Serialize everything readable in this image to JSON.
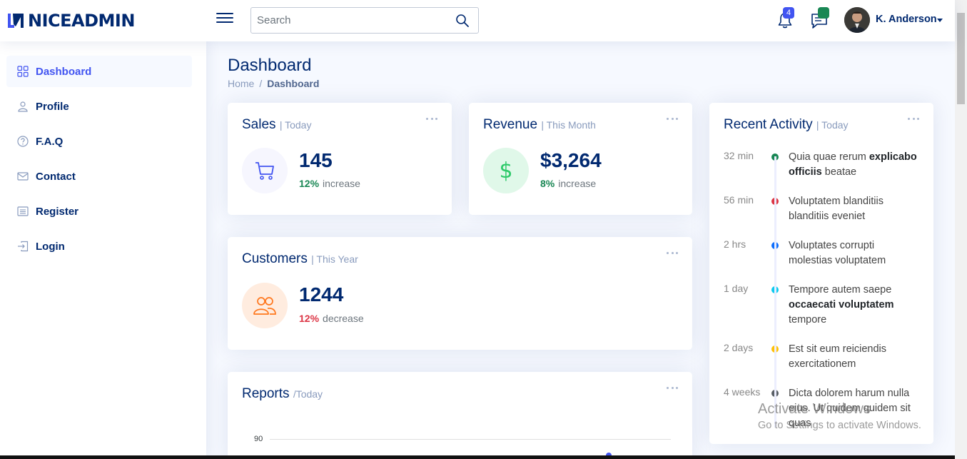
{
  "header": {
    "logo": "NICEADMIN",
    "search_placeholder": "Search",
    "notifications_count": "4",
    "messages_count": "3",
    "user_name": "K. Anderson"
  },
  "sidebar": {
    "items": [
      {
        "label": "Dashboard",
        "icon": "grid-icon",
        "active": true
      },
      {
        "label": "Profile",
        "icon": "person-icon"
      },
      {
        "label": "F.A.Q",
        "icon": "question-circle-icon"
      },
      {
        "label": "Contact",
        "icon": "envelope-icon"
      },
      {
        "label": "Register",
        "icon": "card-list-icon"
      },
      {
        "label": "Login",
        "icon": "box-arrow-in-right-icon"
      }
    ]
  },
  "page": {
    "title": "Dashboard",
    "breadcrumb": [
      "Home",
      "/",
      "Dashboard"
    ]
  },
  "cards": {
    "sales": {
      "title": "Sales",
      "period": "| Today",
      "value": "145",
      "pct": "12%",
      "direction": "increase",
      "icon": "cart-icon",
      "color": "#4154f1"
    },
    "revenue": {
      "title": "Revenue",
      "period": "| This Month",
      "value": "$3,264",
      "pct": "8%",
      "direction": "increase",
      "icon": "currency-dollar-icon",
      "color": "#2eca6a"
    },
    "customers": {
      "title": "Customers",
      "period": "| This Year",
      "value": "1244",
      "pct": "12%",
      "direction": "decrease",
      "icon": "people-icon",
      "color": "#ff771d"
    },
    "reports": {
      "title": "Reports",
      "period": "/Today",
      "axis_label": "90"
    }
  },
  "activity": {
    "title": "Recent Activity",
    "period": "| Today",
    "items": [
      {
        "time": "32 min",
        "color": "#198754",
        "text_before": "Quia quae rerum ",
        "bold": "explicabo officiis",
        "text_after": " beatae"
      },
      {
        "time": "56 min",
        "color": "#dc3545",
        "text_before": "Voluptatem blanditiis blanditiis eveniet",
        "bold": "",
        "text_after": ""
      },
      {
        "time": "2 hrs",
        "color": "#0d6efd",
        "text_before": "Voluptates corrupti molestias voluptatem",
        "bold": "",
        "text_after": ""
      },
      {
        "time": "1 day",
        "color": "#0dcaf0",
        "text_before": "Tempore autem saepe ",
        "bold": "occaecati voluptatem",
        "text_after": " tempore"
      },
      {
        "time": "2 days",
        "color": "#ffc107",
        "text_before": "Est sit eum reiciendis exercitationem",
        "bold": "",
        "text_after": ""
      },
      {
        "time": "4 weeks",
        "color": "#595f66",
        "text_before": "Dicta dolorem harum nulla eius. Ut quidem quidem sit quas",
        "bold": "",
        "text_after": ""
      }
    ]
  },
  "watermark": {
    "line1": "Activate Windows",
    "line2": "Go to Settings to activate Windows."
  }
}
